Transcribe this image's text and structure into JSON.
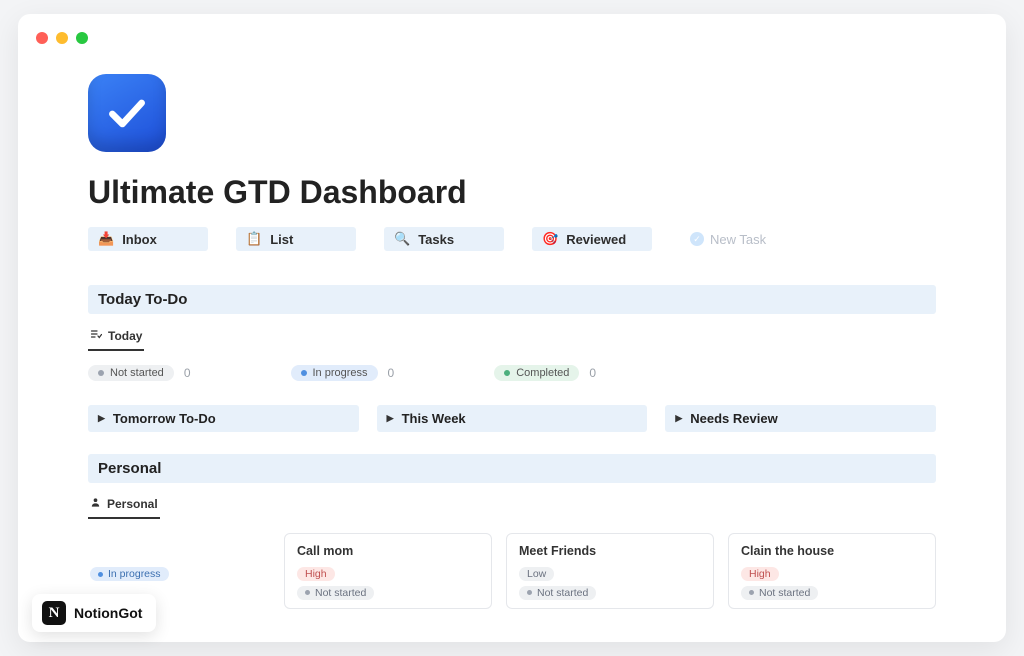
{
  "page": {
    "title": "Ultimate GTD Dashboard"
  },
  "nav": {
    "items": [
      {
        "label": "Inbox",
        "icon": "📥"
      },
      {
        "label": "List",
        "icon": "📋"
      },
      {
        "label": "Tasks",
        "icon": "🔍"
      },
      {
        "label": "Reviewed",
        "icon": "🎯"
      }
    ],
    "new_task_label": "New Task"
  },
  "today": {
    "header": "Today To-Do",
    "tab_label": "Today",
    "statuses": [
      {
        "label": "Not started",
        "count": "0",
        "style": "grey"
      },
      {
        "label": "In progress",
        "count": "0",
        "style": "blue"
      },
      {
        "label": "Completed",
        "count": "0",
        "style": "green"
      }
    ]
  },
  "toggles": [
    {
      "label": "Tomorrow To-Do"
    },
    {
      "label": "This Week"
    },
    {
      "label": "Needs Review"
    }
  ],
  "personal": {
    "header": "Personal",
    "tab_label": "Personal",
    "cards": [
      {
        "title": "",
        "priority": "",
        "status": "In progress",
        "status_style": "prog",
        "cut": true
      },
      {
        "title": "Call mom",
        "priority": "High",
        "priority_style": "high",
        "status": "Not started",
        "status_style": "status"
      },
      {
        "title": "Meet Friends",
        "priority": "Low",
        "priority_style": "low",
        "status": "Not started",
        "status_style": "status"
      },
      {
        "title": "Clain the house",
        "priority": "High",
        "priority_style": "high",
        "status": "Not started",
        "status_style": "status"
      }
    ]
  },
  "watermark": {
    "label": "NotionGot"
  }
}
